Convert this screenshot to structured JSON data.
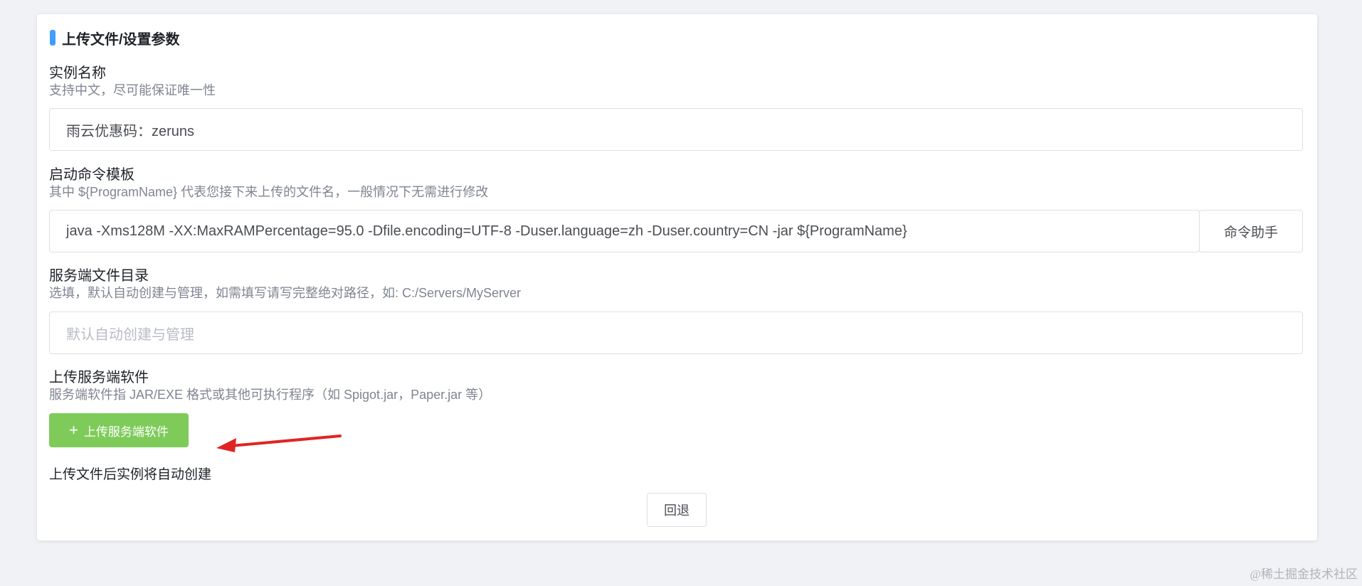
{
  "card": {
    "title": "上传文件/设置参数",
    "accent_color": "#409eff"
  },
  "instance_name": {
    "label": "实例名称",
    "description": "支持中文，尽可能保证唯一性",
    "value": "雨云优惠码：zeruns"
  },
  "start_command": {
    "label": "启动命令模板",
    "description": "其中 ${ProgramName} 代表您接下来上传的文件名，一般情况下无需进行修改",
    "value": "java -Xms128M -XX:MaxRAMPercentage=95.0 -Dfile.encoding=UTF-8 -Duser.language=zh -Duser.country=CN -jar ${ProgramName}",
    "helper_button": "命令助手"
  },
  "server_dir": {
    "label": "服务端文件目录",
    "description": "选填，默认自动创建与管理，如需填写请写完整绝对路径，如: C:/Servers/MyServer",
    "value": "",
    "placeholder": "默认自动创建与管理"
  },
  "upload": {
    "label": "上传服务端软件",
    "description": "服务端软件指 JAR/EXE 格式或其他可执行程序（如 Spigot.jar，Paper.jar 等）",
    "button_icon": "+",
    "button_label": "上传服务端软件",
    "button_color": "#7ecb5a",
    "note": "上传文件后实例将自动创建"
  },
  "back_button": "回退",
  "annotation": {
    "arrow_icon": "red-arrow-icon",
    "arrow_color": "#e02424"
  },
  "watermark": "@稀土掘金技术社区"
}
